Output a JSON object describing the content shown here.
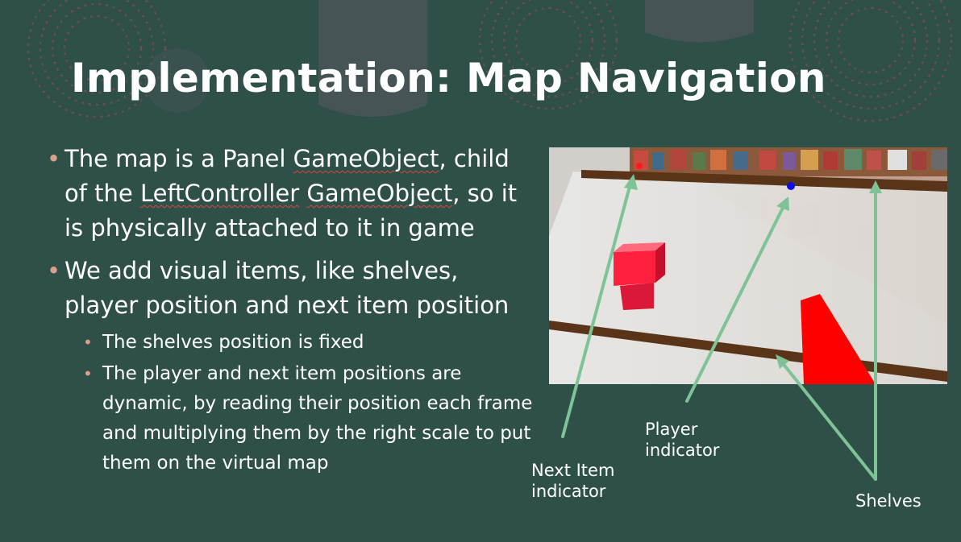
{
  "title": "Implementation: Map Navigation",
  "bullets": {
    "b1": {
      "prefix": "The map is a Panel ",
      "link1": "GameObject",
      "mid": ", child of the ",
      "link2": "LeftController",
      "space": " ",
      "link3": "GameObject",
      "suffix": ", so it is physically attached to it in game"
    },
    "b2": {
      "text": "We add visual items, like shelves, player position and next item position"
    },
    "sub1": {
      "text": "The shelves position is fixed"
    },
    "sub2": {
      "text": "The player and next item positions are dynamic, by reading their position each frame and multiplying them by the right scale to put them on the virtual map"
    }
  },
  "annotations": {
    "player": "Player indicator",
    "next_item": "Next Item indicator",
    "shelves": "Shelves"
  },
  "colors": {
    "background": "#2e5049",
    "bullet": "#d9a08c",
    "arrow": "#7dc395",
    "shelf": "#5a3418",
    "player_dot": "#1010e0",
    "next_item_dot": "#ff1a1a"
  }
}
